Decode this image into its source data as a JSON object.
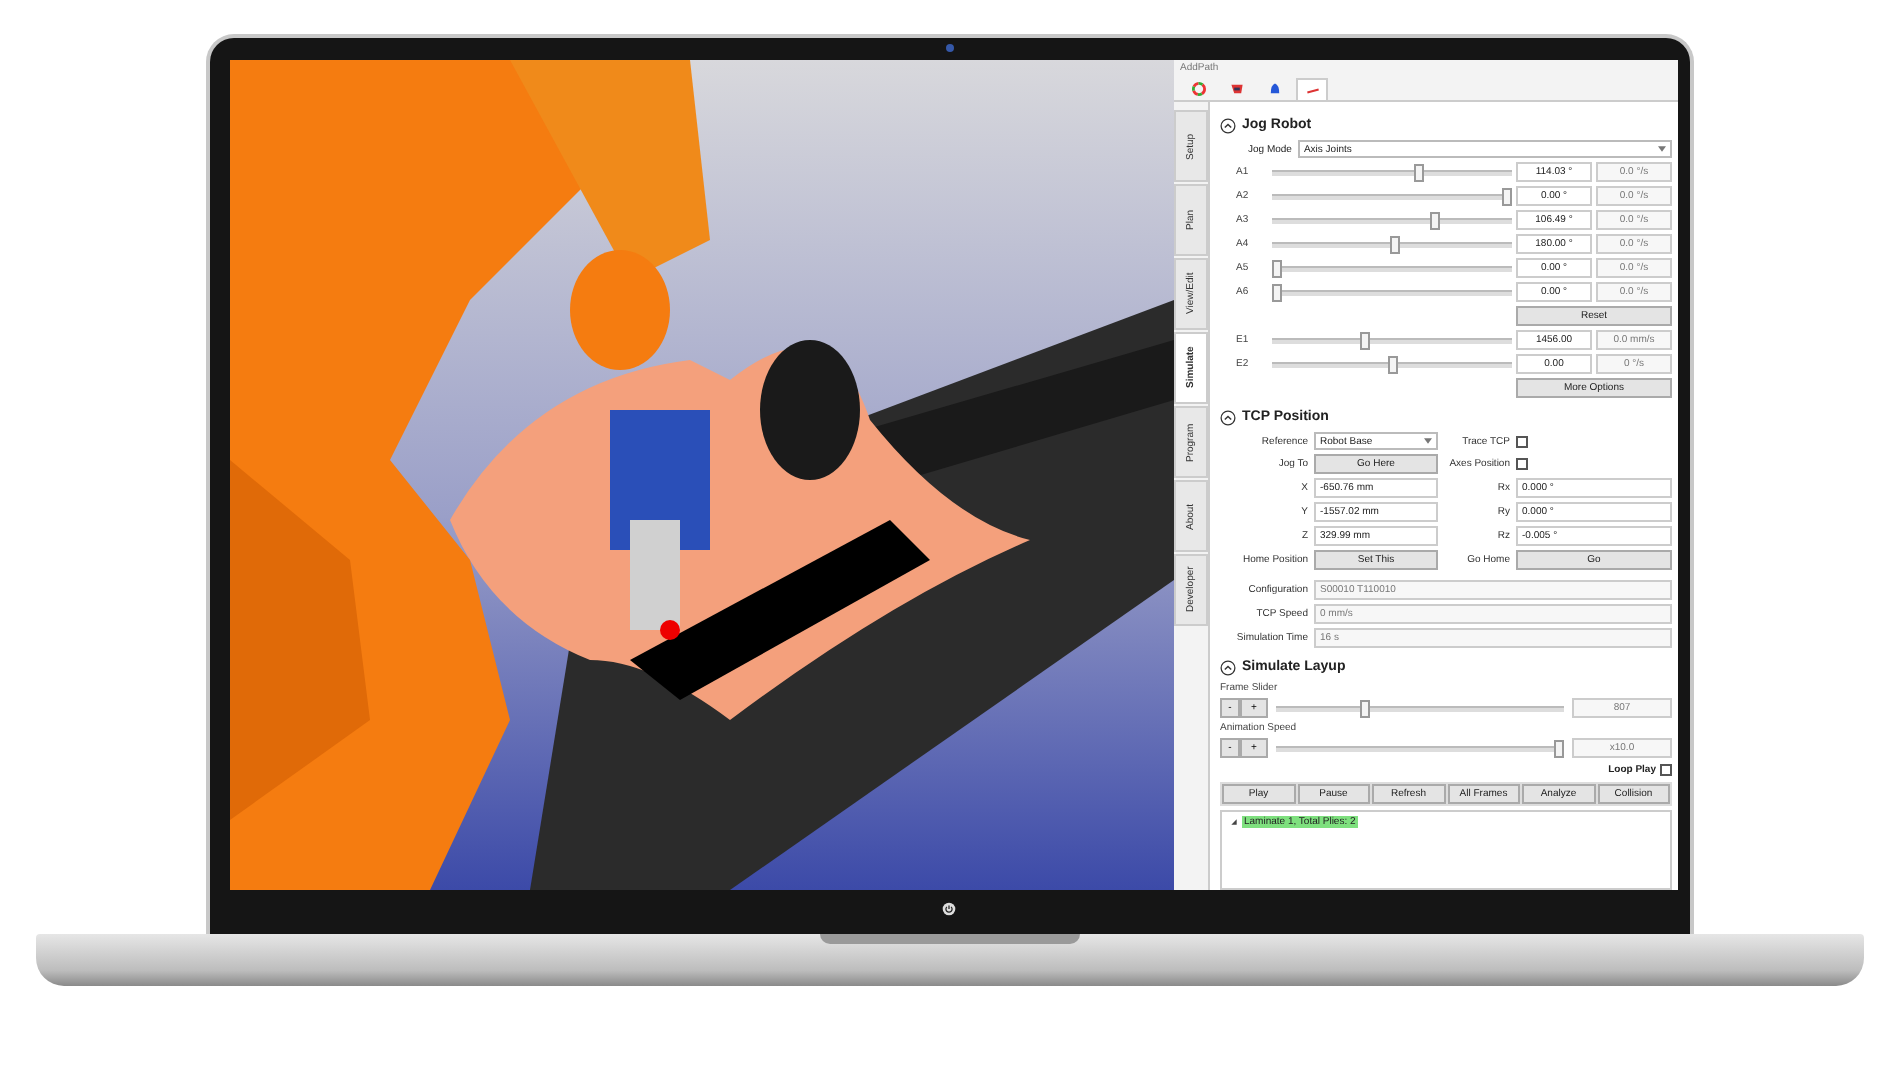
{
  "app_title": "AddPath",
  "top_tabs": [
    {
      "kind": "color-wheel",
      "selected": false
    },
    {
      "kind": "robot",
      "selected": false
    },
    {
      "kind": "bell",
      "selected": false
    },
    {
      "kind": "path",
      "selected": true
    }
  ],
  "side_tabs": [
    {
      "label": "Setup",
      "selected": false
    },
    {
      "label": "Plan",
      "selected": false
    },
    {
      "label": "View/Edit",
      "selected": false
    },
    {
      "label": "Simulate",
      "selected": true
    },
    {
      "label": "Program",
      "selected": false
    },
    {
      "label": "About",
      "selected": false
    },
    {
      "label": "Developer",
      "selected": false
    }
  ],
  "jog_robot": {
    "title": "Jog Robot",
    "expanded": true,
    "jog_mode_label": "Jog Mode",
    "jog_mode_value": "Axis Joints",
    "axes": [
      {
        "name": "A1",
        "level": 0.62,
        "value": "114.03 °",
        "speed": "0.0 °/s"
      },
      {
        "name": "A2",
        "level": 1.0,
        "value": "0.00 °",
        "speed": "0.0 °/s"
      },
      {
        "name": "A3",
        "level": 0.69,
        "value": "106.49 °",
        "speed": "0.0 °/s"
      },
      {
        "name": "A4",
        "level": 0.51,
        "value": "180.00 °",
        "speed": "0.0 °/s"
      },
      {
        "name": "A5",
        "level": 0.0,
        "value": "0.00 °",
        "speed": "0.0 °/s"
      },
      {
        "name": "A6",
        "level": 0.0,
        "value": "0.00 °",
        "speed": "0.0 °/s"
      }
    ],
    "reset": "Reset",
    "externals": [
      {
        "name": "E1",
        "level": 0.38,
        "value": "1456.00",
        "speed": "0.0 mm/s"
      },
      {
        "name": "E2",
        "level": 0.5,
        "value": "0.00",
        "speed": "0 °/s"
      }
    ],
    "more_options": "More Options"
  },
  "tcp_position": {
    "title": "TCP Position",
    "expanded": true,
    "reference_label": "Reference",
    "reference_value": "Robot Base",
    "trace_tcp": {
      "label": "Trace TCP",
      "checked": false
    },
    "jog_to_label": "Jog To",
    "go_here": "Go Here",
    "axes_position": {
      "label": "Axes Position",
      "checked": false
    },
    "coords": [
      {
        "label": "X",
        "value": "-650.76 mm"
      },
      {
        "label": "Y",
        "value": "-1557.02 mm"
      },
      {
        "label": "Z",
        "value": "329.99 mm"
      }
    ],
    "rotations": [
      {
        "label": "Rx",
        "value": "0.000 °"
      },
      {
        "label": "Ry",
        "value": "0.000 °"
      },
      {
        "label": "Rz",
        "value": "-0.005 °"
      }
    ],
    "home_label": "Home Position",
    "set_this": "Set This",
    "go_home_label": "Go Home",
    "go": "Go",
    "readouts": [
      {
        "label": "Configuration",
        "value": "S00010  T110010"
      },
      {
        "label": "TCP Speed",
        "value": "0 mm/s"
      },
      {
        "label": "Simulation Time",
        "value": "16 s"
      }
    ]
  },
  "simulate_layup": {
    "title": "Simulate Layup",
    "expanded": true,
    "sliders": [
      {
        "label": "Frame Slider",
        "minus": "-",
        "plus": "+",
        "level": 0.3,
        "value": "807"
      },
      {
        "label": "Animation Speed",
        "minus": "-",
        "plus": "+",
        "level": 1.0,
        "value": "x10.0"
      }
    ],
    "loop_play": {
      "label": "Loop Play",
      "checked": false
    },
    "buttons": [
      "Play",
      "Pause",
      "Refresh",
      "All Frames",
      "Analyze",
      "Collision"
    ],
    "tree": [
      {
        "label": "Laminate 1, Total Plies: 2",
        "expanded": true
      }
    ]
  }
}
